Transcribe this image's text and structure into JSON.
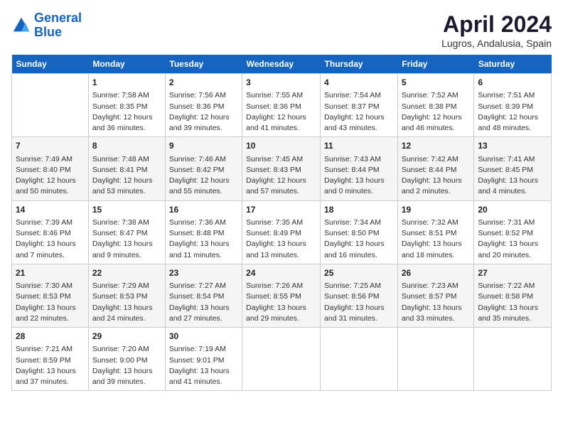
{
  "header": {
    "logo_line1": "General",
    "logo_line2": "Blue",
    "month_title": "April 2024",
    "location": "Lugros, Andalusia, Spain"
  },
  "days_of_week": [
    "Sunday",
    "Monday",
    "Tuesday",
    "Wednesday",
    "Thursday",
    "Friday",
    "Saturday"
  ],
  "weeks": [
    [
      {
        "day": "",
        "content": ""
      },
      {
        "day": "1",
        "content": "Sunrise: 7:58 AM\nSunset: 8:35 PM\nDaylight: 12 hours\nand 36 minutes."
      },
      {
        "day": "2",
        "content": "Sunrise: 7:56 AM\nSunset: 8:36 PM\nDaylight: 12 hours\nand 39 minutes."
      },
      {
        "day": "3",
        "content": "Sunrise: 7:55 AM\nSunset: 8:36 PM\nDaylight: 12 hours\nand 41 minutes."
      },
      {
        "day": "4",
        "content": "Sunrise: 7:54 AM\nSunset: 8:37 PM\nDaylight: 12 hours\nand 43 minutes."
      },
      {
        "day": "5",
        "content": "Sunrise: 7:52 AM\nSunset: 8:38 PM\nDaylight: 12 hours\nand 46 minutes."
      },
      {
        "day": "6",
        "content": "Sunrise: 7:51 AM\nSunset: 8:39 PM\nDaylight: 12 hours\nand 48 minutes."
      }
    ],
    [
      {
        "day": "7",
        "content": "Sunrise: 7:49 AM\nSunset: 8:40 PM\nDaylight: 12 hours\nand 50 minutes."
      },
      {
        "day": "8",
        "content": "Sunrise: 7:48 AM\nSunset: 8:41 PM\nDaylight: 12 hours\nand 53 minutes."
      },
      {
        "day": "9",
        "content": "Sunrise: 7:46 AM\nSunset: 8:42 PM\nDaylight: 12 hours\nand 55 minutes."
      },
      {
        "day": "10",
        "content": "Sunrise: 7:45 AM\nSunset: 8:43 PM\nDaylight: 12 hours\nand 57 minutes."
      },
      {
        "day": "11",
        "content": "Sunrise: 7:43 AM\nSunset: 8:44 PM\nDaylight: 13 hours\nand 0 minutes."
      },
      {
        "day": "12",
        "content": "Sunrise: 7:42 AM\nSunset: 8:44 PM\nDaylight: 13 hours\nand 2 minutes."
      },
      {
        "day": "13",
        "content": "Sunrise: 7:41 AM\nSunset: 8:45 PM\nDaylight: 13 hours\nand 4 minutes."
      }
    ],
    [
      {
        "day": "14",
        "content": "Sunrise: 7:39 AM\nSunset: 8:46 PM\nDaylight: 13 hours\nand 7 minutes."
      },
      {
        "day": "15",
        "content": "Sunrise: 7:38 AM\nSunset: 8:47 PM\nDaylight: 13 hours\nand 9 minutes."
      },
      {
        "day": "16",
        "content": "Sunrise: 7:36 AM\nSunset: 8:48 PM\nDaylight: 13 hours\nand 11 minutes."
      },
      {
        "day": "17",
        "content": "Sunrise: 7:35 AM\nSunset: 8:49 PM\nDaylight: 13 hours\nand 13 minutes."
      },
      {
        "day": "18",
        "content": "Sunrise: 7:34 AM\nSunset: 8:50 PM\nDaylight: 13 hours\nand 16 minutes."
      },
      {
        "day": "19",
        "content": "Sunrise: 7:32 AM\nSunset: 8:51 PM\nDaylight: 13 hours\nand 18 minutes."
      },
      {
        "day": "20",
        "content": "Sunrise: 7:31 AM\nSunset: 8:52 PM\nDaylight: 13 hours\nand 20 minutes."
      }
    ],
    [
      {
        "day": "21",
        "content": "Sunrise: 7:30 AM\nSunset: 8:53 PM\nDaylight: 13 hours\nand 22 minutes."
      },
      {
        "day": "22",
        "content": "Sunrise: 7:29 AM\nSunset: 8:53 PM\nDaylight: 13 hours\nand 24 minutes."
      },
      {
        "day": "23",
        "content": "Sunrise: 7:27 AM\nSunset: 8:54 PM\nDaylight: 13 hours\nand 27 minutes."
      },
      {
        "day": "24",
        "content": "Sunrise: 7:26 AM\nSunset: 8:55 PM\nDaylight: 13 hours\nand 29 minutes."
      },
      {
        "day": "25",
        "content": "Sunrise: 7:25 AM\nSunset: 8:56 PM\nDaylight: 13 hours\nand 31 minutes."
      },
      {
        "day": "26",
        "content": "Sunrise: 7:23 AM\nSunset: 8:57 PM\nDaylight: 13 hours\nand 33 minutes."
      },
      {
        "day": "27",
        "content": "Sunrise: 7:22 AM\nSunset: 8:58 PM\nDaylight: 13 hours\nand 35 minutes."
      }
    ],
    [
      {
        "day": "28",
        "content": "Sunrise: 7:21 AM\nSunset: 8:59 PM\nDaylight: 13 hours\nand 37 minutes."
      },
      {
        "day": "29",
        "content": "Sunrise: 7:20 AM\nSunset: 9:00 PM\nDaylight: 13 hours\nand 39 minutes."
      },
      {
        "day": "30",
        "content": "Sunrise: 7:19 AM\nSunset: 9:01 PM\nDaylight: 13 hours\nand 41 minutes."
      },
      {
        "day": "",
        "content": ""
      },
      {
        "day": "",
        "content": ""
      },
      {
        "day": "",
        "content": ""
      },
      {
        "day": "",
        "content": ""
      }
    ]
  ]
}
